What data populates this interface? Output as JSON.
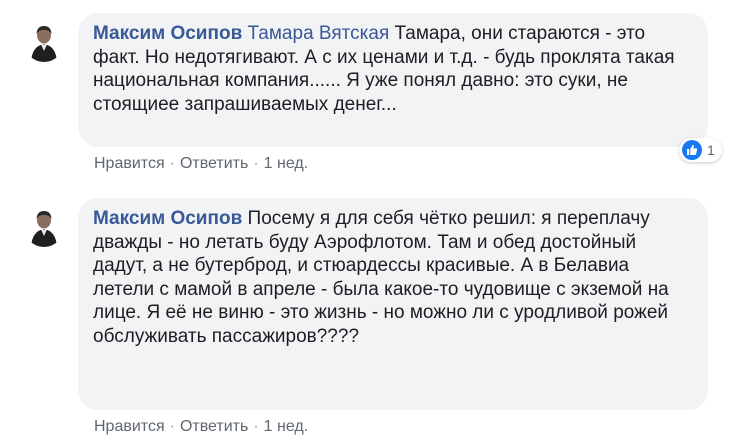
{
  "comments": [
    {
      "author": "Максим Осипов",
      "mention": "Тамара Вятская",
      "text": "Тамара, они стараются - это факт. Но недотягивают. А с их ценами и т.д. - будь проклята такая национальная компания...... Я уже понял давно: это суки, не стоящиее запрашиваемых денег...",
      "actions": {
        "like": "Нравится",
        "reply": "Ответить",
        "time": "1 нед."
      },
      "reaction": {
        "icon": "like-icon",
        "count": "1",
        "color": "#1877f2"
      }
    },
    {
      "author": "Максим Осипов",
      "text": "Посему я для себя чётко решил: я переплачу дважды - но летать буду Аэрофлотом. Там и обед достойный дадут, а не бутерброд, и стюардессы красивые. А в Белавиа летели с мамой в апреле - была какое-то чудовище с экземой на лице. Я её не виню - это жизнь - но можно ли с уродливой рожей обслуживать пассажиров????",
      "actions": {
        "like": "Нравится",
        "reply": "Ответить",
        "time": "1 нед."
      }
    }
  ],
  "separator": "·",
  "colors": {
    "author": "#385898",
    "bubble": "#f2f3f5",
    "muted": "#606770",
    "like": "#1877f2"
  }
}
